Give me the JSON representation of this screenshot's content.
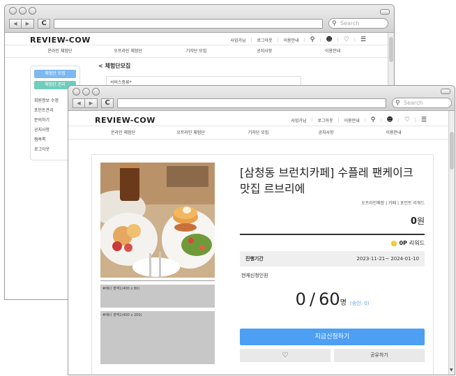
{
  "browser": {
    "search_placeholder": "Search",
    "back_icon": "◀",
    "forward_icon": "▶",
    "reload_icon": "C"
  },
  "site": {
    "logo": "REVIEW-COW",
    "util_links": [
      "사업가님",
      "로그아웃",
      "이용안내"
    ],
    "nav": [
      "온라인 체험단",
      "오프라인 체험단",
      "기자단 모집",
      "공지사항",
      "이용안내"
    ]
  },
  "back_page": {
    "sidebar_buttons": [
      "체험단 모집",
      "체험단 관리"
    ],
    "sidebar_links": [
      "회원정보 수정",
      "포인트관리",
      "문의하기",
      "공지사항",
      "찜목록",
      "로그아웃"
    ],
    "heading": "< 체험단모집",
    "field_label": "서비스종류*"
  },
  "product": {
    "title": "[삼청동 브런치카페] 수플레 팬케이크 맛집 르브리에",
    "tags": "오프라인매장 | 카페 | 포인트 리워드",
    "price_value": "0",
    "price_unit": "원",
    "reward_value": "0P",
    "reward_label": "리워드",
    "period_label": "진행기간",
    "period_value": "2023-11-21~ 2024-01-10",
    "applicants_label": "현재신청인원",
    "applicants_current": "0",
    "applicants_slash": "/",
    "applicants_total": "60",
    "applicants_unit": "명",
    "approved": "(승인: 0)",
    "apply_button": "지금신청하기",
    "share_button": "공유하기",
    "banner1": "#배너 영역1(400 x 80)",
    "banner2": "#배너 영역2(400 x 200)"
  },
  "colors": {
    "apply_blue": "#4d9ff3",
    "sidebar_blue": "#7db8ef",
    "sidebar_teal": "#6fcdbb",
    "reward_coin": "#f2c22c",
    "banner_gray": "#c7c7c7"
  }
}
